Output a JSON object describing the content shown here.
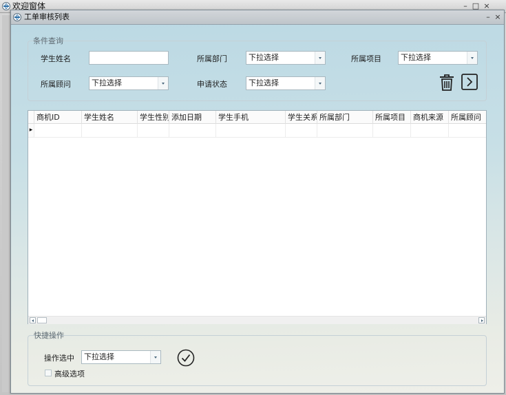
{
  "background_window": {
    "title": "欢迎窗体",
    "controls": {
      "minimize": "–",
      "maximize": "□",
      "close": "×"
    }
  },
  "window": {
    "title": "工单审核列表",
    "controls": {
      "minimize": "–",
      "close": "×"
    }
  },
  "filter": {
    "group_title": "条件查询",
    "student_name_label": "学生姓名",
    "student_name_value": "",
    "department_label": "所属部门",
    "department_value": "下拉选择",
    "project_label": "所属项目",
    "project_value": "下拉选择",
    "consultant_label": "所属顾问",
    "consultant_value": "下拉选择",
    "status_label": "申请状态",
    "status_value": "下拉选择",
    "icons": {
      "clear": "trash-icon",
      "search": "chevron-right-icon"
    }
  },
  "grid": {
    "columns": [
      "商机ID",
      "学生姓名",
      "学生性别",
      "添加日期",
      "学生手机",
      "学生关系",
      "所属部门",
      "所属项目",
      "商机来源",
      "所属顾问"
    ],
    "row_indicator": "▸",
    "rows": []
  },
  "quick": {
    "group_title": "快捷操作",
    "operation_label": "操作选中",
    "operation_value": "下拉选择",
    "advanced_label": "高级选项",
    "advanced_checked": false,
    "confirm_icon": "check-circle-icon"
  },
  "colors": {
    "client_top": "#bcd9e4",
    "client_bottom": "#eeefe9",
    "border": "#a9b8c0"
  }
}
